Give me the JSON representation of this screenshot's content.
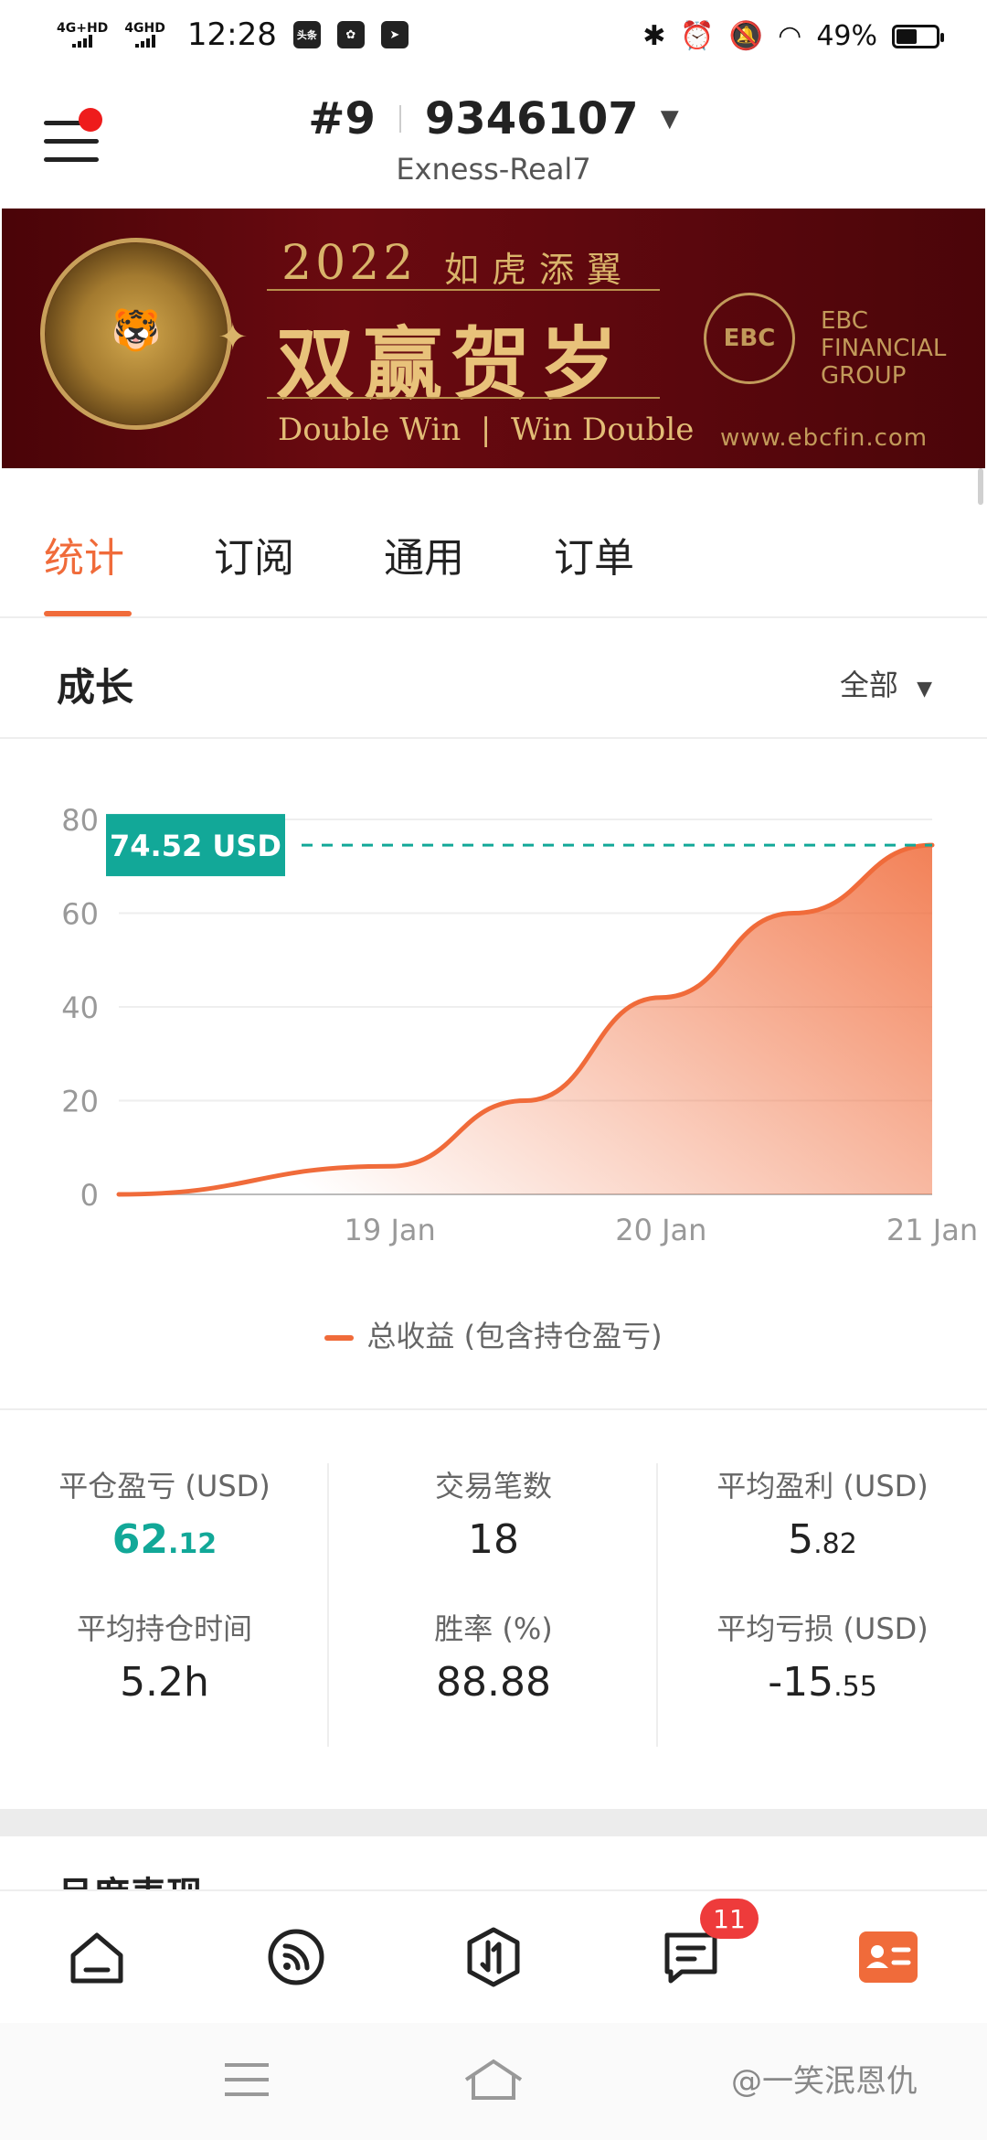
{
  "status_bar": {
    "net1": "4G+HD",
    "net2": "4GHD",
    "time": "12:28",
    "app_icon1": "头条",
    "battery": "49%",
    "battery_level": 0.49
  },
  "header": {
    "account_rank": "#9",
    "account_number": "9346107",
    "server": "Exness-Real7"
  },
  "banner": {
    "year": "2022",
    "subtitle": "如虎添翼",
    "title": "双赢贺岁",
    "tagline": "Double Win  |  Win Double",
    "brand_mark": "EBC",
    "brand_name": "EBC FINANCIAL GROUP",
    "url": "www.ebcfin.com"
  },
  "tabs": [
    {
      "label": "统计",
      "active": true
    },
    {
      "label": "订阅",
      "active": false
    },
    {
      "label": "通用",
      "active": false
    },
    {
      "label": "订单",
      "active": false
    }
  ],
  "section": {
    "title": "成长",
    "filter": "全部"
  },
  "chart_data": {
    "type": "area",
    "x": [
      "18 Jan",
      "19 Jan",
      "19.5 Jan",
      "20 Jan",
      "20.5 Jan",
      "21 Jan"
    ],
    "x_ticks": [
      "19 Jan",
      "20 Jan",
      "21 Jan"
    ],
    "y_ticks": [
      "0",
      "20",
      "40",
      "60",
      "80"
    ],
    "ylim": [
      0,
      80
    ],
    "series": [
      {
        "name": "总收益 (包含持仓盈亏)",
        "values": [
          0,
          6,
          20,
          42,
          60,
          74.52
        ]
      }
    ],
    "last_value_label": "74.52 USD",
    "colors": {
      "line": "#f06b3a",
      "marker": "#12a898"
    },
    "grid": true
  },
  "stats": {
    "closed_pl": {
      "label": "平仓盈亏 (USD)",
      "int": "62",
      "dec": ".12"
    },
    "trades": {
      "label": "交易笔数",
      "value": "18"
    },
    "avg_profit": {
      "label": "平均盈利 (USD)",
      "int": "5",
      "dec": ".82"
    },
    "avg_hold": {
      "label": "平均持仓时间",
      "value": "5.2h"
    },
    "win_rate": {
      "label": "胜率 (%)",
      "value": "88.88"
    },
    "avg_loss": {
      "label": "平均亏损 (USD)",
      "int": "-15",
      "dec": ".55"
    }
  },
  "peek_title": "月度表现",
  "nav": {
    "badge": "11",
    "items": [
      "home-icon",
      "feed-icon",
      "trade-icon",
      "messages-icon",
      "profile-icon"
    ]
  },
  "watermark": "@一笑泯恩仇",
  "colors": {
    "accent": "#f06b3a",
    "teal": "#12a898",
    "badge": "#ee3b3b"
  }
}
